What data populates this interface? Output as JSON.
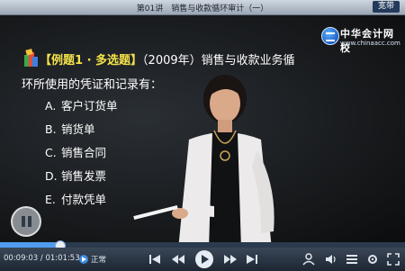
{
  "header": {
    "title": "第01讲　销售与收款循环审计（一）",
    "mode_button": "宽带"
  },
  "logo": {
    "name": "中华会计网校",
    "url": "www.chinaacc.com"
  },
  "slide": {
    "question_tag": "【例题1 · 多选题】",
    "question_text_line1": "（2009年）销售与收款业务循",
    "question_text_line2": "环所使用的凭证和记录有：",
    "options": [
      {
        "key": "A.",
        "text": "客户订货单"
      },
      {
        "key": "B.",
        "text": "销货单"
      },
      {
        "key": "C.",
        "text": "销售合同"
      },
      {
        "key": "D.",
        "text": "销售发票"
      },
      {
        "key": "E.",
        "text": "付款凭单"
      }
    ]
  },
  "player": {
    "time_display": "00:09:03 / 01:01:53",
    "speed_label": "正常",
    "progress_fraction": 0.146
  },
  "colors": {
    "accent_blue": "#4f9cf0",
    "question_tag": "#f4e24a"
  }
}
